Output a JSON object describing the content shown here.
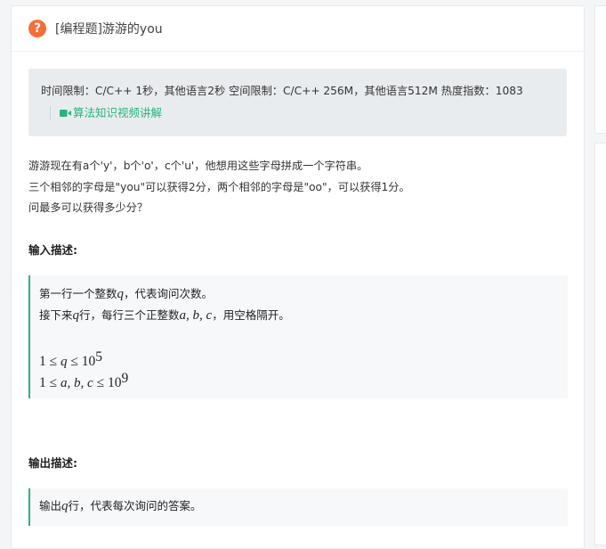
{
  "header": {
    "title": "[编程题]游游的you",
    "icon_glyph": "?"
  },
  "limits": {
    "text": "时间限制：C/C++ 1秒，其他语言2秒  空间限制：C/C++ 256M，其他语言512M  热度指数：1083",
    "video_link": "算法知识视频讲解"
  },
  "description": {
    "lines": [
      "游游现在有a个'y'，b个'o'，c个'u'，他想用这些字母拼成一个字符串。",
      "三个相邻的字母是\"you\"可以获得2分，两个相邻的字母是\"oo\"，可以获得1分。",
      "问最多可以获得多少分？"
    ]
  },
  "input": {
    "label": "输入描述:",
    "line1_pre": "第一行一个整数",
    "line1_var": "q",
    "line1_post": "，代表询问次数。",
    "line2_pre": "接下来",
    "line2_var": "q",
    "line2_mid": "行，每行三个正整数",
    "line2_vars": "a, b, c",
    "line2_post": "，用空格隔开。",
    "c1_left": "1 ≤ ",
    "c1_var": "q",
    "c1_right": " ≤ 10",
    "c1_exp": "5",
    "c2_left": "1 ≤ ",
    "c2_vars": "a, b, c",
    "c2_right": " ≤ 10",
    "c2_exp": "9"
  },
  "output": {
    "label": "输出描述:",
    "line_pre": "输出",
    "line_var": "q",
    "line_post": "行，代表每次询问的答案。"
  },
  "colors": {
    "accent": "#27b57c",
    "icon": "#f56e37"
  }
}
